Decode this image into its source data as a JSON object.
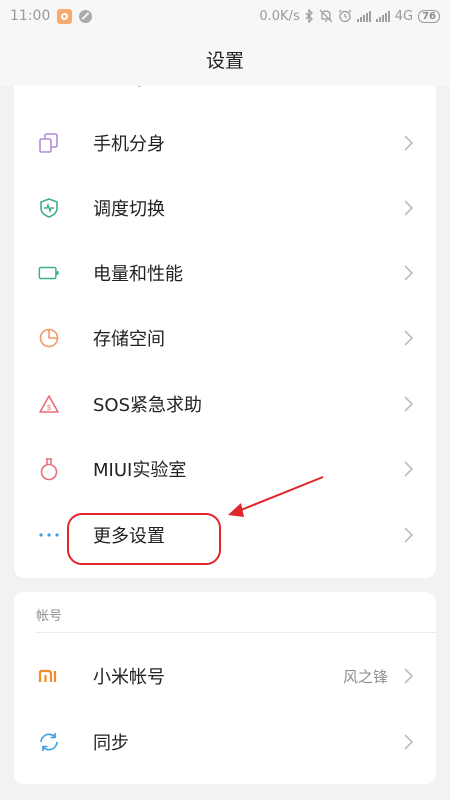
{
  "status_bar": {
    "time": "11:00",
    "network_speed": "0.0K/s",
    "network_type": "4G",
    "battery_level": "76",
    "icons": [
      "app-badge-icon",
      "blocked-icon",
      "bluetooth-icon",
      "mute-icon",
      "alarm-icon",
      "signal-icon",
      "signal-icon"
    ]
  },
  "header": {
    "title": "设置"
  },
  "main_section": {
    "items": [
      {
        "label": "手机分身",
        "icon": "dual-apps-icon",
        "color": "#b48ad9"
      },
      {
        "label": "调度切换",
        "icon": "shield-switch-icon",
        "color": "#3fae8e"
      },
      {
        "label": "电量和性能",
        "icon": "battery-icon",
        "color": "#3fae8e"
      },
      {
        "label": "存储空间",
        "icon": "storage-pie-icon",
        "color": "#f29a62"
      },
      {
        "label": "SOS紧急求助",
        "icon": "sos-icon",
        "color": "#ea6d7b"
      },
      {
        "label": "MIUI实验室",
        "icon": "flask-icon",
        "color": "#ea6d7b"
      },
      {
        "label": "更多设置",
        "icon": "more-dots-icon",
        "color": "#3a9ee4"
      }
    ]
  },
  "account_section": {
    "header": "帐号",
    "items": [
      {
        "label": "小米帐号",
        "value": "风之锋",
        "icon": "mi-logo-icon",
        "color": "#f28c28"
      },
      {
        "label": "同步",
        "icon": "sync-icon",
        "color": "#3a9ee4"
      }
    ]
  },
  "annotation": {
    "color": "#e0262b"
  }
}
